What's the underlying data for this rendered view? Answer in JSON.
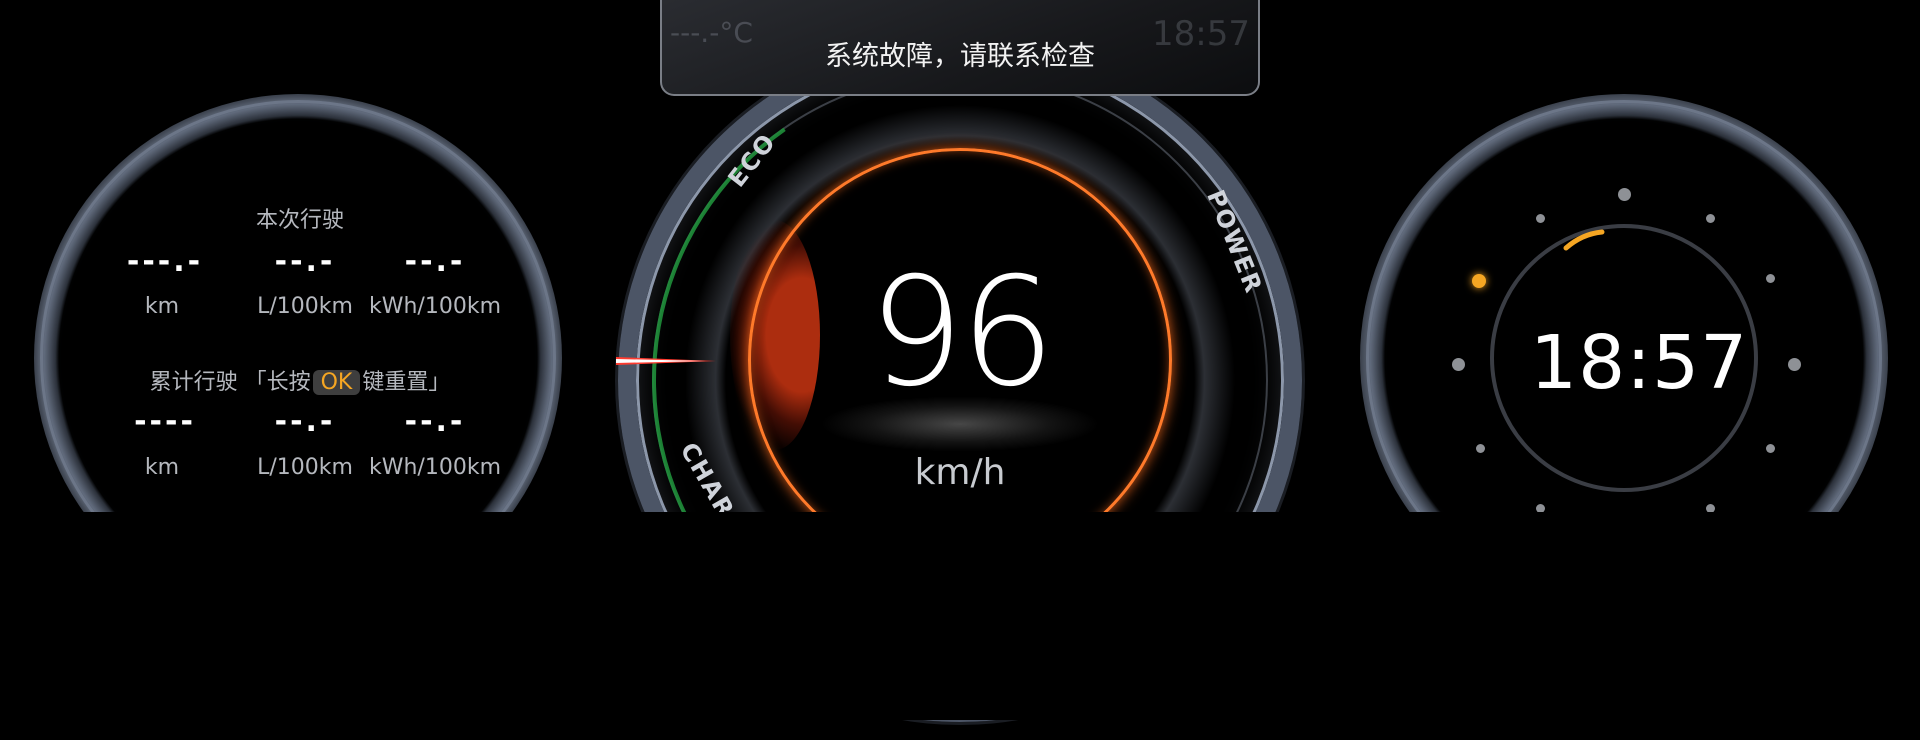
{
  "banner": {
    "message": "系统故障，请联系检查",
    "faint_temp": "---.-°C",
    "faint_time": "18:57"
  },
  "speedometer": {
    "speed": "96",
    "unit": "km/h",
    "mode_labels": {
      "eco": "ECO",
      "power": "POWER",
      "charge": "CHARGE"
    }
  },
  "trip": {
    "current": {
      "title": "本次行驶",
      "values": [
        "---.-",
        "--.-",
        "--.-"
      ],
      "units": [
        "km",
        "L/100km",
        "kWh/100km"
      ]
    },
    "total": {
      "title_prefix": "累计行驶 「长按",
      "ok": "OK",
      "title_suffix": "键重置」",
      "values": [
        "----",
        "--.-",
        "--.-"
      ],
      "units": [
        "km",
        "L/100km",
        "kWh/100km"
      ]
    }
  },
  "clock": {
    "time": "18:57"
  },
  "colors": {
    "accent": "#ff7a2a",
    "charge": "#1f8f3a",
    "indicator": "#f5a623"
  }
}
